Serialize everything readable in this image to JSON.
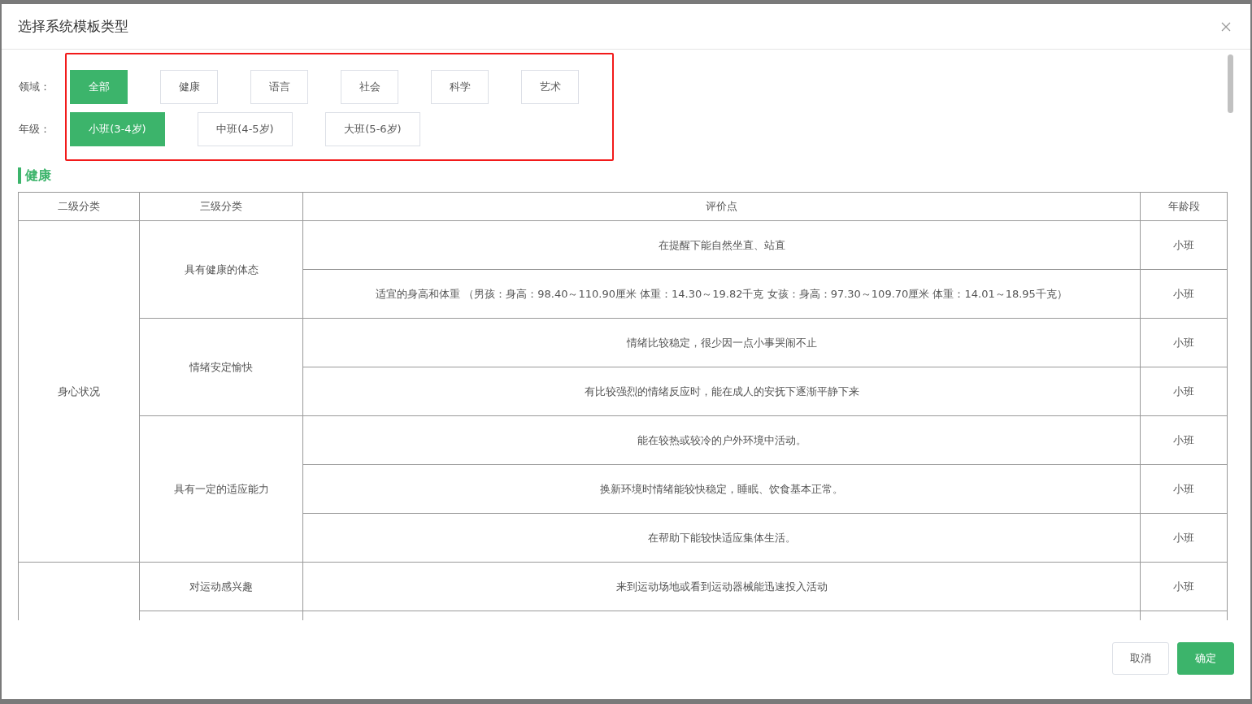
{
  "dialog": {
    "title": "选择系统模板类型"
  },
  "filters": [
    {
      "label": "领域：",
      "options": [
        {
          "label": "全部",
          "selected": true
        },
        {
          "label": "健康",
          "selected": false
        },
        {
          "label": "语言",
          "selected": false
        },
        {
          "label": "社会",
          "selected": false
        },
        {
          "label": "科学",
          "selected": false
        },
        {
          "label": "艺术",
          "selected": false
        }
      ]
    },
    {
      "label": "年级：",
      "options": [
        {
          "label": "小班(3-4岁)",
          "selected": true
        },
        {
          "label": "中班(4-5岁)",
          "selected": false
        },
        {
          "label": "大班(5-6岁)",
          "selected": false
        }
      ]
    }
  ],
  "section": {
    "title": "健康"
  },
  "table": {
    "columns": [
      "二级分类",
      "三级分类",
      "评价点",
      "年龄段"
    ],
    "groups": [
      {
        "name": "身心状况",
        "subs": [
          {
            "name": "具有健康的体态",
            "points": [
              {
                "text": "在提醒下能自然坐直、站直",
                "age": "小班"
              },
              {
                "text": "适宜的身高和体重 （男孩：身高：98.40～110.90厘米 体重：14.30～19.82千克 女孩：身高：97.30～109.70厘米 体重：14.01～18.95千克）",
                "age": "小班"
              }
            ]
          },
          {
            "name": "情绪安定愉快",
            "points": [
              {
                "text": "情绪比较稳定，很少因一点小事哭闹不止",
                "age": "小班"
              },
              {
                "text": "有比较强烈的情绪反应时，能在成人的安抚下逐渐平静下来",
                "age": "小班"
              }
            ]
          },
          {
            "name": "具有一定的适应能力",
            "points": [
              {
                "text": "能在较热或较冷的户外环境中活动。",
                "age": "小班"
              },
              {
                "text": "换新环境时情绪能较快稳定，睡眠、饮食基本正常。",
                "age": "小班"
              },
              {
                "text": "在帮助下能较快适应集体生活。",
                "age": "小班"
              }
            ]
          }
        ]
      },
      {
        "subs": [
          {
            "name": "对运动感兴趣",
            "points": [
              {
                "text": "来到运动场地或看到运动器械能迅速投入活动",
                "age": "小班"
              }
            ]
          }
        ]
      }
    ]
  },
  "buttons": {
    "cancel": "取消",
    "confirm": "确定"
  }
}
